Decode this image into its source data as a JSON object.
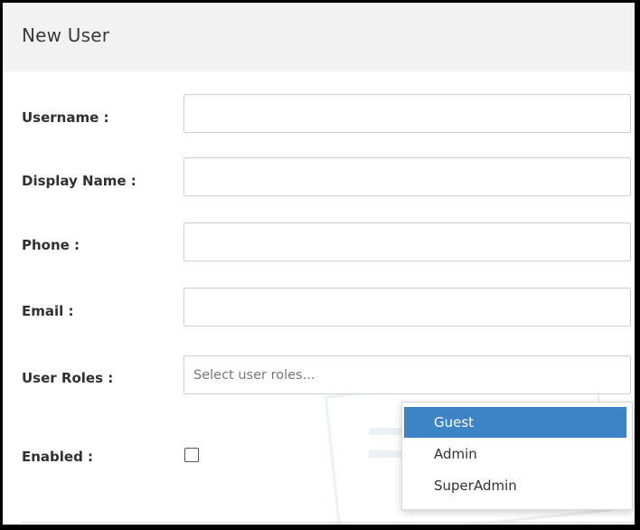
{
  "dialog": {
    "title": "New User"
  },
  "form": {
    "username_label": "Username :",
    "display_name_label": "Display Name :",
    "phone_label": "Phone :",
    "email_label": "Email :",
    "user_roles_label": "User Roles :",
    "enabled_label": "Enabled :",
    "username_value": "",
    "display_name_value": "",
    "phone_value": "",
    "email_value": "",
    "roles_placeholder": "Select user roles...",
    "enabled": false
  },
  "roles_dropdown": {
    "options": [
      "Guest",
      "Admin",
      "SuperAdmin"
    ],
    "highlighted": "Guest"
  },
  "colors": {
    "header_bg": "#f2f2f2",
    "highlight": "#3c84c6",
    "frame": "#000000"
  }
}
